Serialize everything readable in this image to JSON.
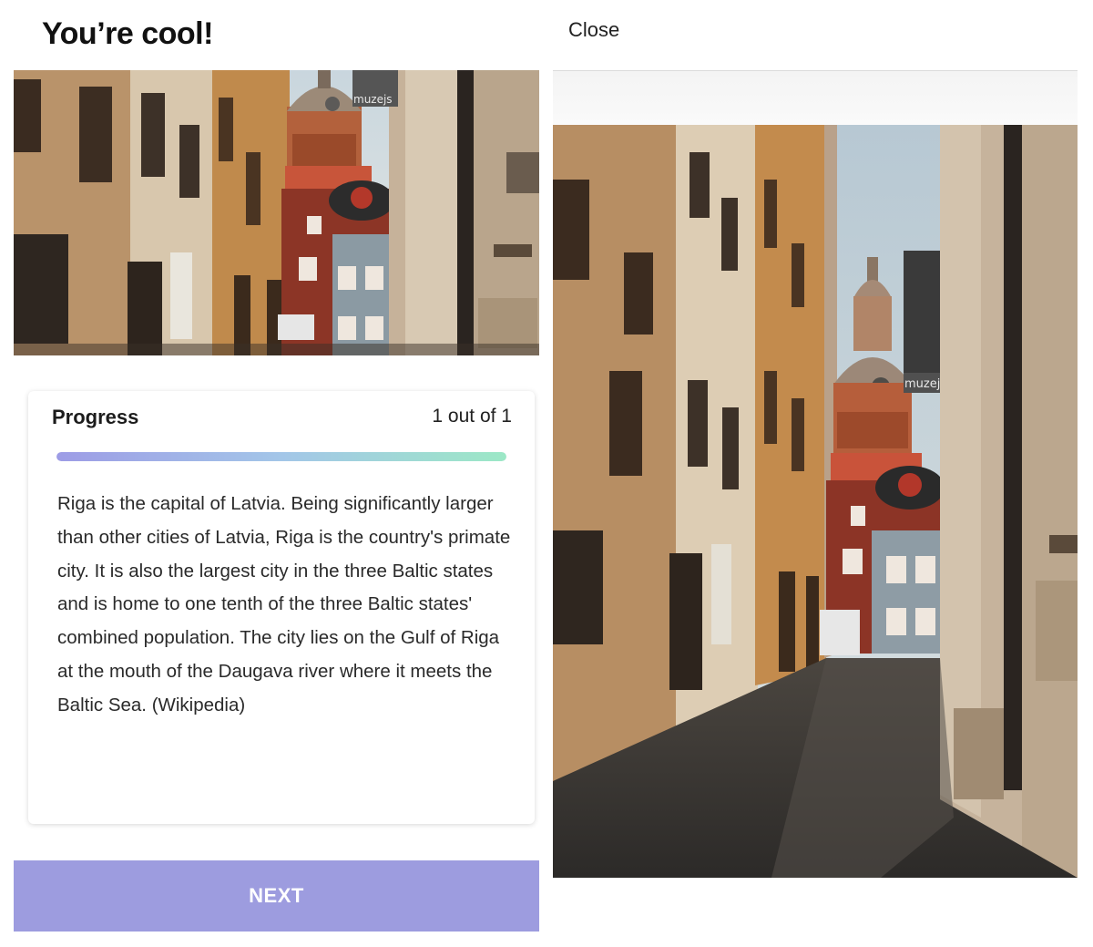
{
  "quiz_screen": {
    "title": "You’re cool!",
    "sign_text": "muzejs",
    "carousel": {
      "total": 2,
      "active_index": 0
    },
    "progress": {
      "label": "Progress",
      "count_text": "1 out of 1",
      "fraction": 1.0
    },
    "description": "Riga is the capital of Latvia. Being significantly larger than other cities of Latvia, Riga is the country's primate city. It is also the largest city in the three Baltic states and is home to one tenth of the three Baltic states' combined population. The city lies on the Gulf of Riga at the mouth of the Daugava river where it meets the Baltic Sea. (Wikipedia)",
    "next_label": "NEXT"
  },
  "photo_screen": {
    "close_label": "Close",
    "sign_text": "muzejs"
  },
  "colors": {
    "accent": "#9d9cdf",
    "progress_gradient_start": "#9d9ce6",
    "progress_gradient_end": "#9ce8c6"
  }
}
